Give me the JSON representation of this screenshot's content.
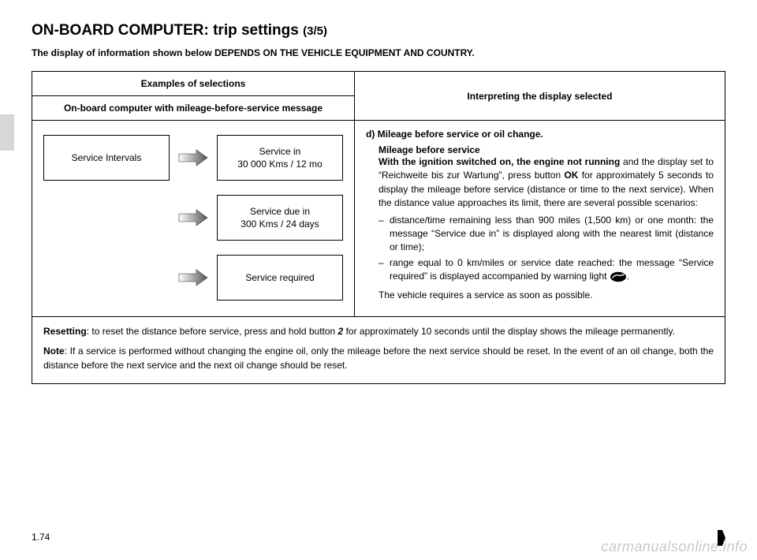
{
  "title_main": "ON-BOARD COMPUTER: trip settings ",
  "title_sub": "(3/5)",
  "depends_note": "The display of information shown below DEPENDS ON THE VEHICLE EQUIPMENT AND COUNTRY.",
  "table": {
    "hdr_left_top": "Examples of selections",
    "hdr_left_bottom": "On-board computer with mileage-before-service message",
    "hdr_right": "Interpreting the display selected"
  },
  "screens": {
    "s1_line1": "Service Intervals",
    "s2_line1": "Service in",
    "s2_line2": "30 000 Kms / 12 mo",
    "s3_line1": "Service due in",
    "s3_line2": "300 Kms / 24 days",
    "s4_line1": "Service required"
  },
  "right": {
    "heading": "d) Mileage before service or oil change.",
    "sub": "Mileage before service",
    "p1a": "With the ignition switched on, the engine not running",
    "p1b": " and the display set to “Reichweite bis zur Wartung”, press button ",
    "p1c": "OK",
    "p1d": "  for approximately 5 seconds to display the mileage before service (distance or time to the next service). When the distance value approaches its limit, there are several possible scenarios:",
    "li1a": "distance/time remaining less than ",
    "li1b": "900 miles (1,500 km)",
    "li1c": " or ",
    "li1d": "one month",
    "li1e": ": the message “Service due in” is displayed along with the nearest limit (distance or time);",
    "li2a": "range equal to ",
    "li2b": "0 km/miles",
    "li2c": " or ",
    "li2d": "service date reached:",
    "li2e": " the message “Service required” is displayed accompanied by warning light ",
    "li2f": ".",
    "after": "The vehicle requires a service as soon as possible."
  },
  "footer": {
    "reset_b": "Resetting",
    "reset_1": ": to reset the distance before service, press and hold button ",
    "reset_btn": "2",
    "reset_2": " for approximately 10 seconds until the display shows the mileage permanently.",
    "note_b": "Note",
    "note_1": ": If a service is performed without changing the engine oil, only the mileage before the next service should be reset. In the event of an oil change, both the distance before the next service and the next oil change should be reset."
  },
  "page_num": "1.74",
  "watermark": "carmanualsonline.info"
}
